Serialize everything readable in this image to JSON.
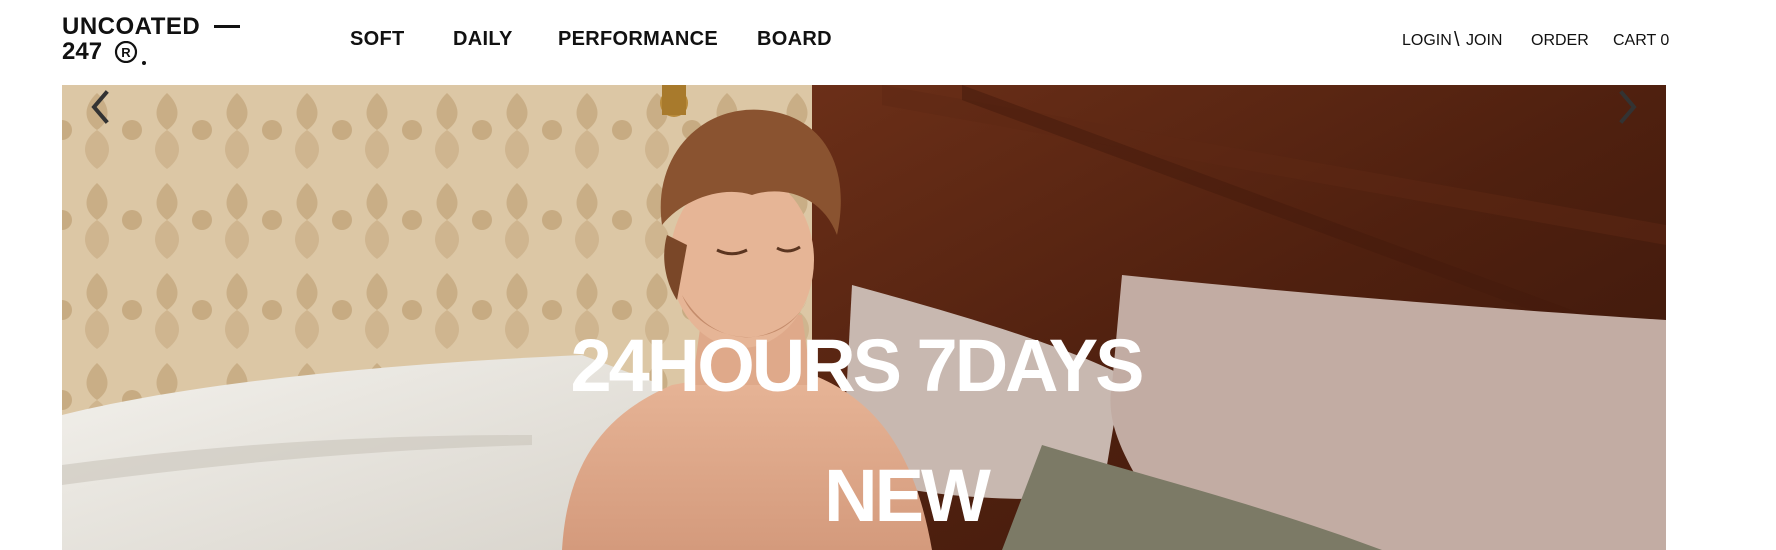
{
  "brand": {
    "line1": "UNCOATED",
    "line2": "247",
    "reg_mark": "R"
  },
  "nav": {
    "items": [
      {
        "label": "SOFT"
      },
      {
        "label": "DAILY"
      },
      {
        "label": "PERFORMANCE"
      },
      {
        "label": "BOARD"
      }
    ]
  },
  "utility": {
    "login": "LOGIN",
    "separator": "\\",
    "join": "JOIN",
    "order": "ORDER",
    "cart": "CART 0"
  },
  "hero": {
    "headline": "24HOURS 7DAYS",
    "subheadline": "NEW",
    "prev_icon": "chevron-left-icon",
    "next_icon": "chevron-right-icon"
  },
  "colors": {
    "text": "#111111",
    "hero_text": "#ffffff",
    "arrow": "#333333"
  }
}
